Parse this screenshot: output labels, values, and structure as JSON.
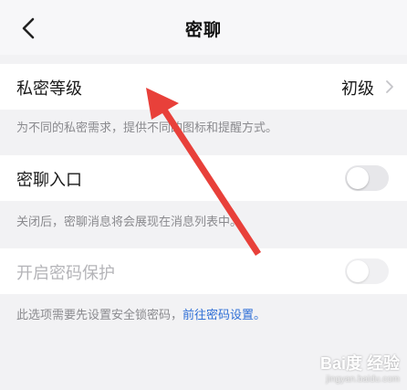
{
  "header": {
    "title": "密聊",
    "back_icon": "chevron-left-icon"
  },
  "privacy_level": {
    "label": "私密等级",
    "value": "初级"
  },
  "privacy_note": "为不同的私密需求，提供不同的图标和提醒方式。",
  "entry": {
    "label": "密聊入口",
    "toggle_on": false
  },
  "entry_note": "关闭后，密聊消息将会展现在消息列表中。",
  "password": {
    "label": "开启密码保护",
    "toggle_on": false,
    "enabled": false
  },
  "password_note": {
    "text": "此选项需要先设置安全锁密码，",
    "link": "前往密码设置。"
  },
  "watermark": {
    "brand": "Bai度 经验",
    "url": "jingyan.baidu.com"
  },
  "colors": {
    "link": "#2f6fd6",
    "annotation_arrow": "#e8403a"
  }
}
